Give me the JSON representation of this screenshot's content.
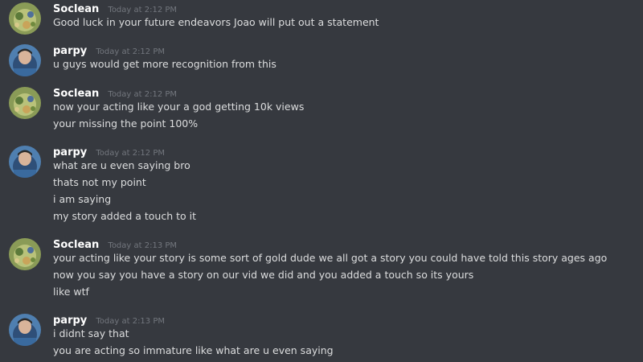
{
  "messages": [
    {
      "author": "Soclean",
      "timestamp": "Today at 2:12 PM",
      "avatar": "soclean-avatar",
      "lines": [
        "Good luck in your future endeavors Joao will put out a statement"
      ]
    },
    {
      "author": "parpy",
      "timestamp": "Today at 2:12 PM",
      "avatar": "parpy-avatar",
      "lines": [
        "u guys would get more recognition from this"
      ]
    },
    {
      "author": "Soclean",
      "timestamp": "Today at 2:12 PM",
      "avatar": "soclean-avatar",
      "lines": [
        "now your acting like your a god getting 10k views",
        "your missing the point 100%"
      ]
    },
    {
      "author": "parpy",
      "timestamp": "Today at 2:12 PM",
      "avatar": "parpy-avatar",
      "lines": [
        "what are u even saying bro",
        "thats not my point",
        "i am saying",
        "my story added a touch to it"
      ]
    },
    {
      "author": "Soclean",
      "timestamp": "Today at 2:13 PM",
      "avatar": "soclean-avatar",
      "lines": [
        "your acting like your story is some sort of gold dude we all got a story you could have told this story ages ago",
        "now you say you have a story on our vid we did and you added a touch so its yours",
        "like wtf"
      ]
    },
    {
      "author": "parpy",
      "timestamp": "Today at 2:13 PM",
      "avatar": "parpy-avatar",
      "lines": [
        "i didnt say that",
        "you are acting so immature like what are u even saying"
      ]
    }
  ],
  "colors": {
    "background": "#36393f",
    "username": "#ffffff",
    "timestamp": "#72767d",
    "message_text": "#dcddde"
  }
}
